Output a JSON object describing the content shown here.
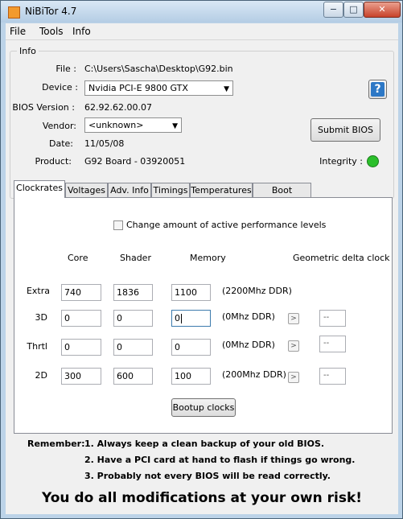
{
  "window": {
    "title": "NiBiTor 4.7",
    "controls": {
      "minimize": "−",
      "maximize": "□",
      "close": "✕"
    }
  },
  "menu": [
    "File",
    "Tools",
    "Info"
  ],
  "info": {
    "group_label": "Info",
    "file_label": "File :",
    "file_value": "C:\\Users\\Sascha\\Desktop\\G92.bin",
    "device_label": "Device :",
    "device_value": "Nvidia PCI-E 9800 GTX",
    "bios_label": "BIOS Version :",
    "bios_value": "62.92.62.00.07",
    "vendor_label": "Vendor:",
    "vendor_value": "<unknown>",
    "date_label": "Date:",
    "date_value": "11/05/08",
    "product_label": "Product:",
    "product_value": "G92 Board - 03920051",
    "submit_label": "Submit BIOS",
    "help_glyph": "?",
    "integrity_label": "Integrity :",
    "integrity_color": "#2bbf2b"
  },
  "tabs": [
    "Clockrates",
    "Voltages",
    "Adv. Info",
    "Timings",
    "Temperatures",
    "Boot Settings"
  ],
  "active_tab": "Clockrates",
  "clockrates": {
    "change_levels_label": "Change amount of active performance levels",
    "change_levels_checked": false,
    "headers": {
      "core": "Core",
      "shader": "Shader",
      "memory": "Memory",
      "delta": "Geometric delta clock"
    },
    "rows": [
      {
        "label": "Extra",
        "core": "740",
        "shader": "1836",
        "memory": "1100",
        "ddr": "(2200Mhz DDR)",
        "delta": null
      },
      {
        "label": "3D",
        "core": "0",
        "shader": "0",
        "memory": "0",
        "ddr": "(0Mhz DDR)",
        "delta": "--"
      },
      {
        "label": "Thrtl",
        "core": "0",
        "shader": "0",
        "memory": "0",
        "ddr": "(0Mhz DDR)",
        "delta": "--"
      },
      {
        "label": "2D",
        "core": "300",
        "shader": "600",
        "memory": "100",
        "ddr": "(200Mhz DDR)",
        "delta": "--"
      }
    ],
    "arrow_glyph": ">",
    "bootup_label": "Bootup clocks"
  },
  "footer": {
    "remember_label": "Remember:",
    "items": [
      "1. Always keep a clean backup of your old BIOS.",
      "2. Have a PCI card at hand to flash if things go wrong.",
      "3. Probably not every BIOS will be read correctly."
    ],
    "warning": "You do all modifications at your own risk!"
  }
}
